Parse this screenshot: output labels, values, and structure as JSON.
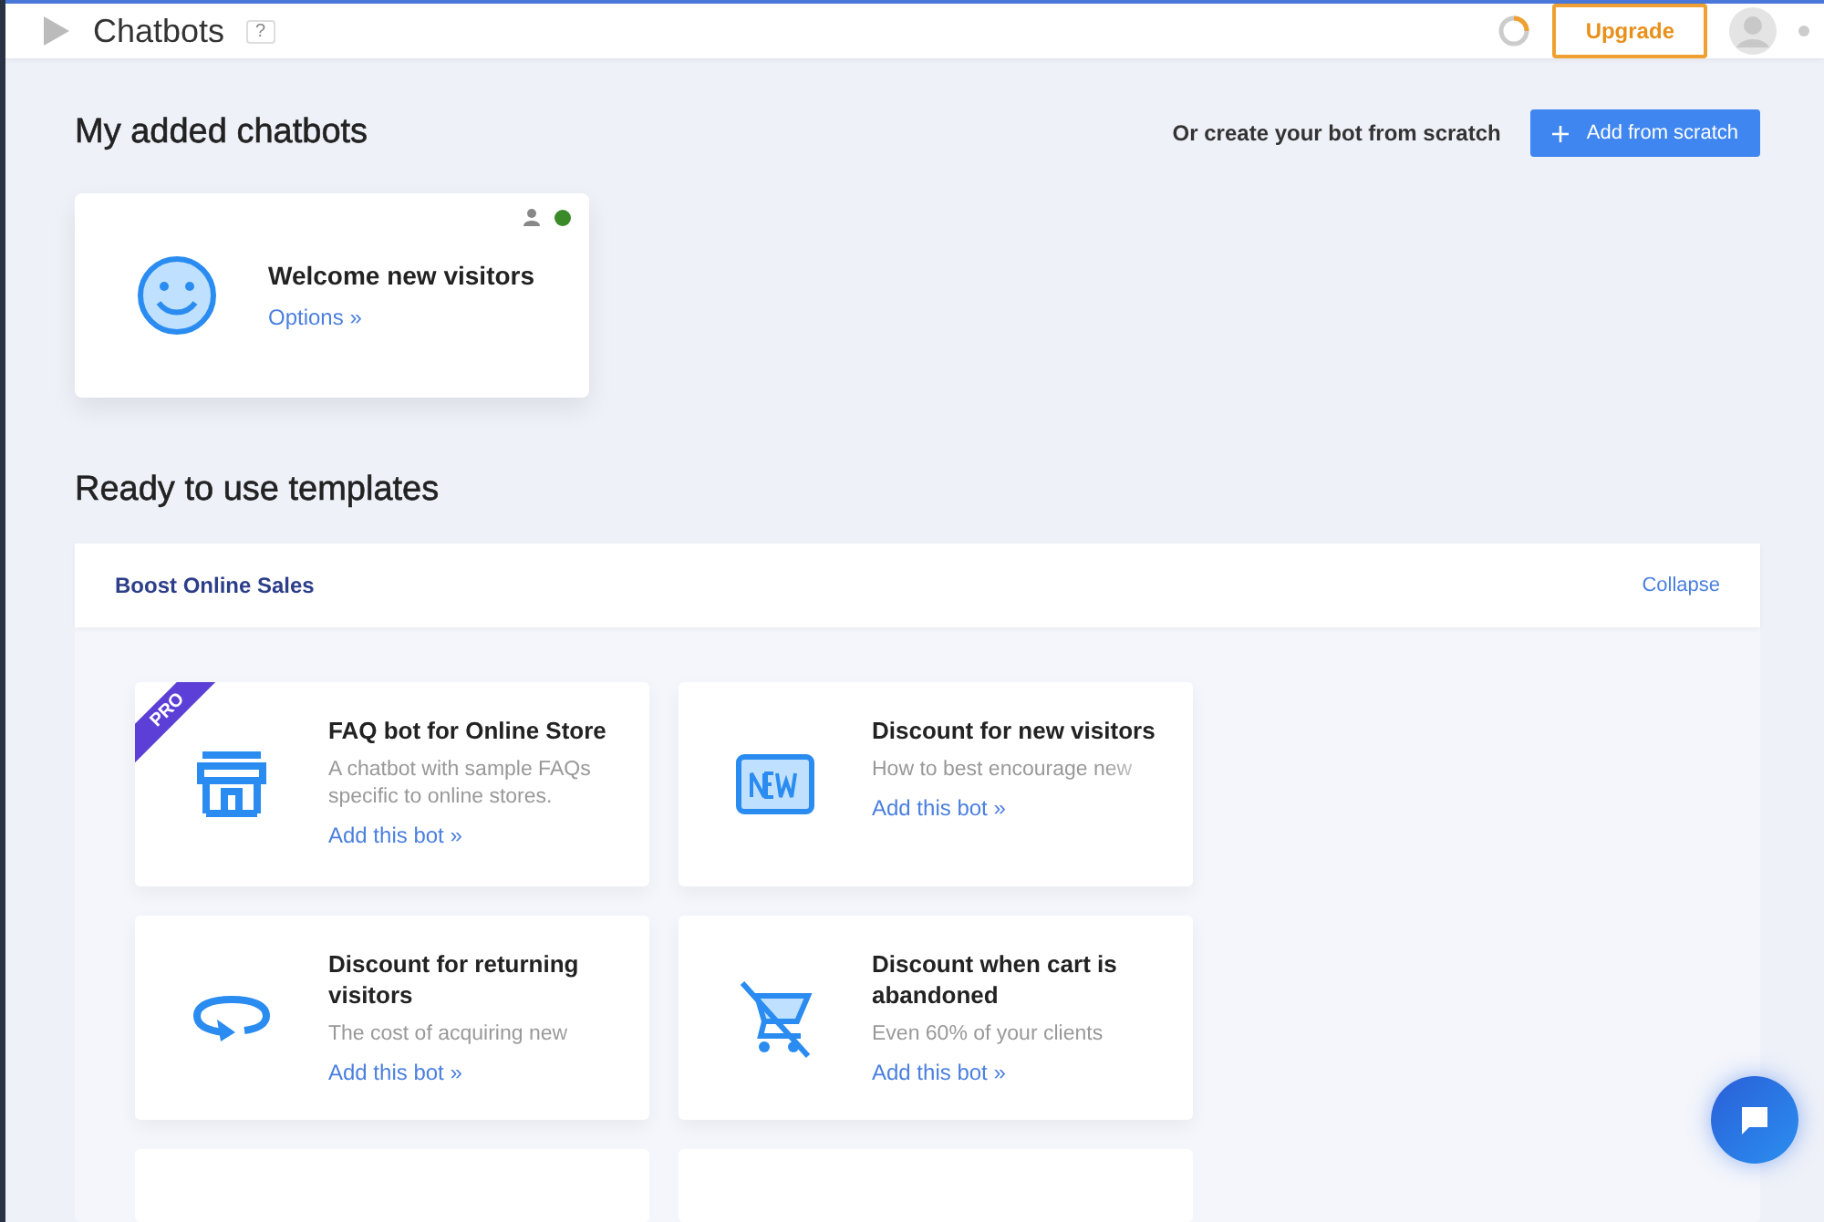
{
  "header": {
    "title": "Chatbots",
    "help": "?",
    "upgrade": "Upgrade"
  },
  "added": {
    "heading": "My added chatbots",
    "create_text": "Or create your bot from scratch",
    "create_button": "Add from scratch",
    "bots": [
      {
        "name": "Welcome new visitors",
        "link": "Options »",
        "online": true
      }
    ]
  },
  "templates": {
    "heading": "Ready to use templates",
    "group": {
      "title": "Boost Online Sales",
      "toggle": "Collapse",
      "items": [
        {
          "kind": "store",
          "pro": true,
          "badge": "PRO",
          "title": "FAQ bot for Online Store",
          "description": "A chatbot with sample FAQs specific to online stores.",
          "link": "Add this bot »"
        },
        {
          "kind": "new",
          "pro": false,
          "title": "Discount for new visitors",
          "description": "How to best encourage new",
          "link": "Add this bot »"
        },
        {
          "kind": "return",
          "pro": false,
          "title": "Discount for returning visitors",
          "description": "The cost of acquiring new",
          "link": "Add this bot »"
        },
        {
          "kind": "cart",
          "pro": false,
          "title": "Discount when cart is abandoned",
          "description": "Even 60% of your clients",
          "link": "Add this bot »"
        }
      ]
    }
  }
}
